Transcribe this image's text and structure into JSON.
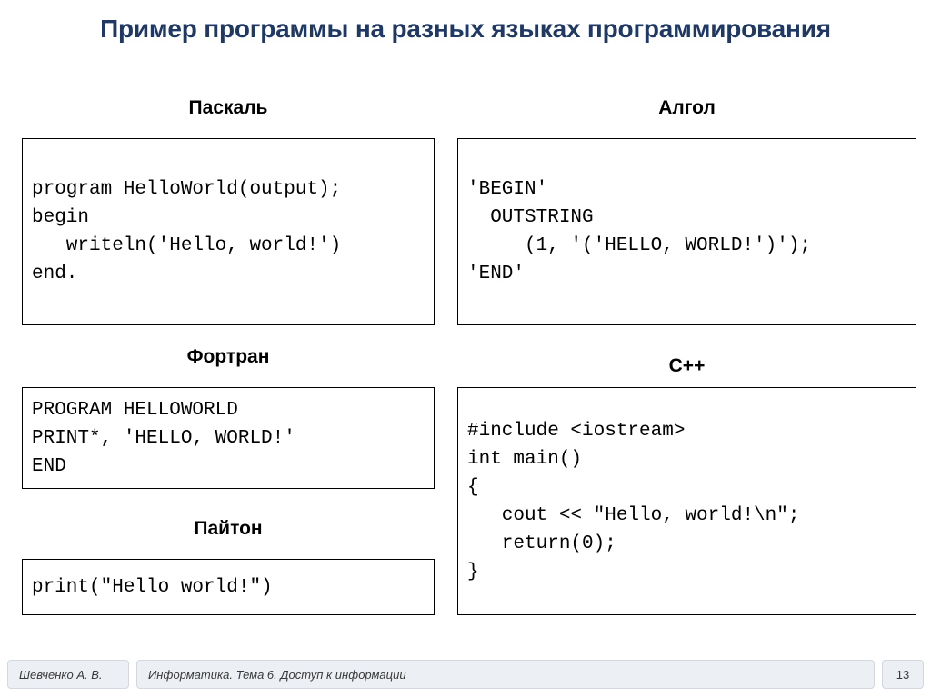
{
  "slide": {
    "title": "Пример программы на разных языках программирования"
  },
  "examples": {
    "pascal": {
      "heading": "Паскаль",
      "code": "program HelloWorld(output);\nbegin\n   writeln('Hello, world!')\nend."
    },
    "algol": {
      "heading": "Алгол",
      "code": "'BEGIN'\n  OUTSTRING\n     (1, '('HELLO, WORLD!')');\n'END'"
    },
    "fortran": {
      "heading": "Фортран",
      "code": "PROGRAM HELLOWORLD\nPRINT*, 'HELLO, WORLD!'\nEND"
    },
    "cpp": {
      "heading": "C++",
      "code": "#include <iostream>\nint main()\n{\n   cout << \"Hello, world!\\n\";\n   return(0);\n}"
    },
    "python": {
      "heading": "Пайтон",
      "code": "print(\"Hello world!\")"
    }
  },
  "footer": {
    "author": "Шевченко А. В.",
    "course": "Информатика. Тема 6. Доступ к информации",
    "page_number": "13"
  }
}
